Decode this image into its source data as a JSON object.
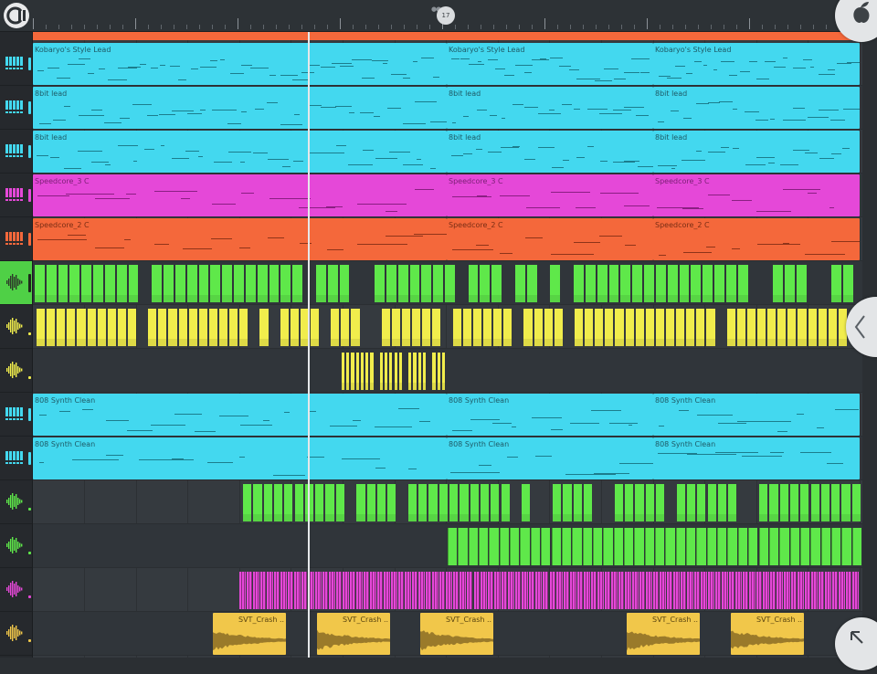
{
  "app": {
    "playhead_bar": "17",
    "icons": {
      "menu": "fl-menu-icon",
      "fruit": "fl-fruit-icon",
      "panel": "chevron-left-icon",
      "expand": "arrow-up-left-icon"
    }
  },
  "colors": {
    "cyan": "#43d8ef",
    "magenta": "#e548d8",
    "orange": "#f4683b",
    "green": "#5fe84a",
    "yellow": "#f1ed4c",
    "crash": "#f1c74a",
    "background": "#353a3f",
    "sidebar": "#26292d"
  },
  "tracks": [
    {
      "icon": "piano-icon",
      "icon_color": "#43d8ef",
      "clips": [
        {
          "label": "Kobaryo's Style Lead",
          "start": 0,
          "end": 453,
          "color": "cyan",
          "kind": "melody",
          "dense": 40
        },
        {
          "label": "Kobaryo's Style Lead",
          "start": 453,
          "end": 679,
          "color": "cyan",
          "kind": "melody",
          "dense": 22
        },
        {
          "label": "Kobaryo's Style Lead",
          "start": 679,
          "end": 905,
          "color": "cyan",
          "kind": "melody",
          "dense": 22
        }
      ]
    },
    {
      "icon": "piano-icon",
      "icon_color": "#43d8ef",
      "clips": [
        {
          "label": "8bit lead",
          "start": 0,
          "end": 453,
          "color": "cyan",
          "kind": "melody",
          "dense": 30
        },
        {
          "label": "8bit lead",
          "start": 453,
          "end": 679,
          "color": "cyan",
          "kind": "melody",
          "dense": 16
        },
        {
          "label": "8bit lead",
          "start": 679,
          "end": 905,
          "color": "cyan",
          "kind": "melody",
          "dense": 16
        }
      ]
    },
    {
      "icon": "piano-icon",
      "icon_color": "#43d8ef",
      "clips": [
        {
          "label": "8bit lead",
          "start": 0,
          "end": 453,
          "color": "cyan",
          "kind": "melody",
          "dense": 30
        },
        {
          "label": "8bit lead",
          "start": 453,
          "end": 679,
          "color": "cyan",
          "kind": "melody",
          "dense": 16
        },
        {
          "label": "8bit lead",
          "start": 679,
          "end": 905,
          "color": "cyan",
          "kind": "melody",
          "dense": 16
        }
      ]
    },
    {
      "icon": "piano-icon",
      "icon_color": "#e548d8",
      "clips": [
        {
          "label": "Speedcore_3 C",
          "start": 0,
          "end": 453,
          "color": "magenta",
          "kind": "melody",
          "dense": 14
        },
        {
          "label": "Speedcore_3 C",
          "start": 453,
          "end": 679,
          "color": "magenta",
          "kind": "melody",
          "dense": 8
        },
        {
          "label": "Speedcore_3 C",
          "start": 679,
          "end": 905,
          "color": "magenta",
          "kind": "melody",
          "dense": 8
        }
      ]
    },
    {
      "icon": "piano-icon",
      "icon_color": "#f4683b",
      "clips": [
        {
          "label": "Speedcore_2 C",
          "start": 0,
          "end": 453,
          "color": "orange",
          "kind": "melody",
          "dense": 14
        },
        {
          "label": "Speedcore_2 C",
          "start": 453,
          "end": 679,
          "color": "orange",
          "kind": "melody",
          "dense": 8
        },
        {
          "label": "Speedcore_2 C",
          "start": 679,
          "end": 905,
          "color": "orange",
          "kind": "melody",
          "dense": 8
        }
      ]
    },
    {
      "icon": "waveform-icon",
      "icon_color": "#2d3a2a",
      "selected": true,
      "clips": [
        {
          "label": "",
          "start": 2,
          "end": 900,
          "color": "green",
          "kind": "beats",
          "dense": 70
        }
      ]
    },
    {
      "icon": "waveform-icon",
      "icon_color": "#f1ed4c",
      "clips": [
        {
          "label": "",
          "start": 4,
          "end": 893,
          "color": "yellow",
          "kind": "beats",
          "dense": 80
        }
      ]
    },
    {
      "icon": "waveform-icon",
      "icon_color": "#f1ed4c",
      "clips": [
        {
          "label": "",
          "start": 338,
          "end": 453,
          "color": "yellow",
          "kind": "beats",
          "dense": 22
        }
      ]
    },
    {
      "icon": "piano-icon",
      "icon_color": "#43d8ef",
      "clips": [
        {
          "label": "808 Synth Clean",
          "start": 0,
          "end": 453,
          "color": "cyan",
          "kind": "melody",
          "dense": 18
        },
        {
          "label": "808 Synth Clean",
          "start": 453,
          "end": 679,
          "color": "cyan",
          "kind": "melody",
          "dense": 10
        },
        {
          "label": "808 Synth Clean",
          "start": 679,
          "end": 905,
          "color": "cyan",
          "kind": "melody",
          "dense": 10
        }
      ]
    },
    {
      "icon": "piano-icon",
      "icon_color": "#43d8ef",
      "clips": [
        {
          "label": "808 Synth Clean",
          "start": 0,
          "end": 453,
          "color": "cyan",
          "kind": "melody",
          "dense": 12
        },
        {
          "label": "808 Synth Clean",
          "start": 453,
          "end": 679,
          "color": "cyan",
          "kind": "melody",
          "dense": 7
        },
        {
          "label": "808 Synth Clean",
          "start": 679,
          "end": 905,
          "color": "cyan",
          "kind": "melody",
          "dense": 7
        }
      ]
    },
    {
      "icon": "waveform-icon",
      "icon_color": "#5fe84a",
      "clips": [
        {
          "label": "",
          "start": 230,
          "end": 908,
          "color": "green",
          "kind": "beats",
          "dense": 60
        }
      ]
    },
    {
      "icon": "waveform-icon",
      "icon_color": "#5fe84a",
      "clips": [
        {
          "label": "",
          "start": 454,
          "end": 908,
          "color": "green",
          "kind": "arrows",
          "dense": 40
        }
      ]
    },
    {
      "icon": "waveform-icon",
      "icon_color": "#e548d8",
      "clips": [
        {
          "label": "",
          "start": 226,
          "end": 905,
          "color": "magenta",
          "kind": "hats",
          "dense": 90
        }
      ]
    },
    {
      "icon": "waveform-icon",
      "icon_color": "#f1c74a",
      "clips": [
        {
          "label": "SVT_Crash ..",
          "start": 197,
          "end": 277,
          "color": "crash",
          "kind": "wave",
          "dense": 0
        },
        {
          "label": "SVT_Crash ..",
          "start": 311,
          "end": 391,
          "color": "crash",
          "kind": "wave",
          "dense": 0
        },
        {
          "label": "SVT_Crash ..",
          "start": 424,
          "end": 504,
          "color": "crash",
          "kind": "wave",
          "dense": 0
        },
        {
          "label": "SVT_Crash ..",
          "start": 650,
          "end": 730,
          "color": "crash",
          "kind": "wave",
          "dense": 0
        },
        {
          "label": "SVT_Crash ..",
          "start": 764,
          "end": 844,
          "color": "crash",
          "kind": "wave",
          "dense": 0
        }
      ]
    }
  ]
}
